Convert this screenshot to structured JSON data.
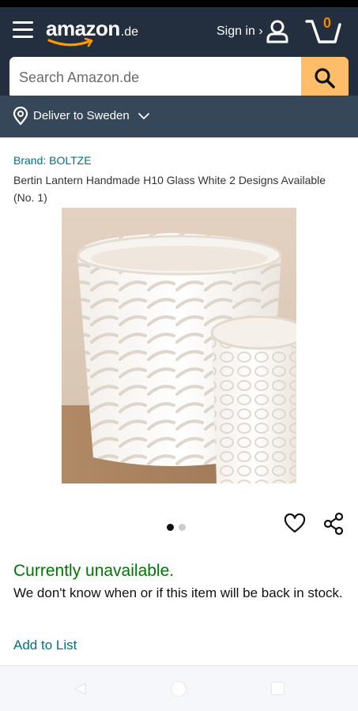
{
  "header": {
    "logo": "amazon",
    "logo_suffix": ".de",
    "sign_in_label": "Sign in ›",
    "cart_count": "0",
    "icons": [
      "menu-icon",
      "user-icon",
      "cart-icon"
    ]
  },
  "search": {
    "placeholder": "Search Amazon.de",
    "icon": "search-icon"
  },
  "delivery": {
    "label": "Deliver to Sweden",
    "icons": [
      "location-pin-icon",
      "chevron-down-icon"
    ]
  },
  "product": {
    "brand": "Brand: BOLTZE",
    "title": "Bertin Lantern Handmade H10 Glass White 2 Designs Available (No. 1)",
    "image_alt": "White textured glass lanterns",
    "image_count": 2,
    "active_image_index": 0
  },
  "actions": {
    "icons": [
      "heart-icon",
      "share-icon"
    ]
  },
  "availability": {
    "status": "Currently unavailable.",
    "note": "We don't know when or if this item will be back in stock.",
    "add_to_list": "Add to List"
  },
  "colors": {
    "header_bg": "#232f3e",
    "deliver_bg": "#37475a",
    "search_button": "#febd69",
    "link": "#007185",
    "unavailable": "#007600",
    "cart_count": "#f08804"
  }
}
